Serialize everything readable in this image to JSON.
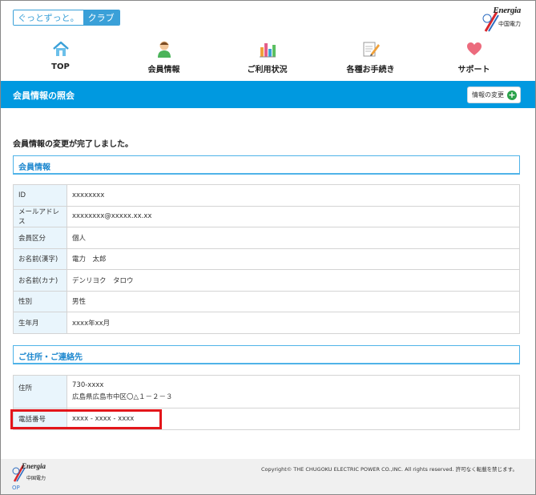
{
  "header": {
    "logo_part1": "ぐっとずっと。",
    "logo_part2": "クラブ",
    "brand_word": "Energia",
    "brand_sub": "中国電力"
  },
  "nav": [
    {
      "label": "TOP",
      "icon": "house-icon"
    },
    {
      "label": "会員情報",
      "icon": "person-icon"
    },
    {
      "label": "ご利用状況",
      "icon": "bar-chart-icon"
    },
    {
      "label": "各種お手続き",
      "icon": "notepad-pencil-icon"
    },
    {
      "label": "サポート",
      "icon": "heart-icon"
    }
  ],
  "page": {
    "title": "会員情報の照会",
    "edit_button": "情報の変更",
    "complete_message": "会員情報の変更が完了しました。"
  },
  "member_section": {
    "heading": "会員情報",
    "rows": [
      {
        "label": "ID",
        "value": "xxxxxxxx"
      },
      {
        "label": "メールアドレス",
        "value": "xxxxxxxx@xxxxx.xx.xx"
      },
      {
        "label": "会員区分",
        "value": "個人"
      },
      {
        "label": "お名前(漢字)",
        "value": "電力　太郎"
      },
      {
        "label": "お名前(カナ)",
        "value": "デンリヨク　タロウ"
      },
      {
        "label": "性別",
        "value": "男性"
      },
      {
        "label": "生年月",
        "value": "xxxx年xx月"
      }
    ]
  },
  "address_section": {
    "heading": "ご住所・ご連絡先",
    "address_label": "住所",
    "postal": "730-xxxx",
    "address": "広島県広島市中区〇△１－２－３",
    "phone_label": "電話番号",
    "phone": "xxxx - xxxx - xxxx"
  },
  "footer": {
    "copyright": "Copyright© THE CHUGOKU ELECTRIC POWER CO.,INC. All rights reserved. 許可なく転載を禁じます。",
    "brand_word": "Energia",
    "brand_sub": "中国電力",
    "op": "OP"
  },
  "colors": {
    "accent_blue": "#0099e0",
    "highlight_red": "#e3151a",
    "plus_green": "#2aa24a"
  }
}
